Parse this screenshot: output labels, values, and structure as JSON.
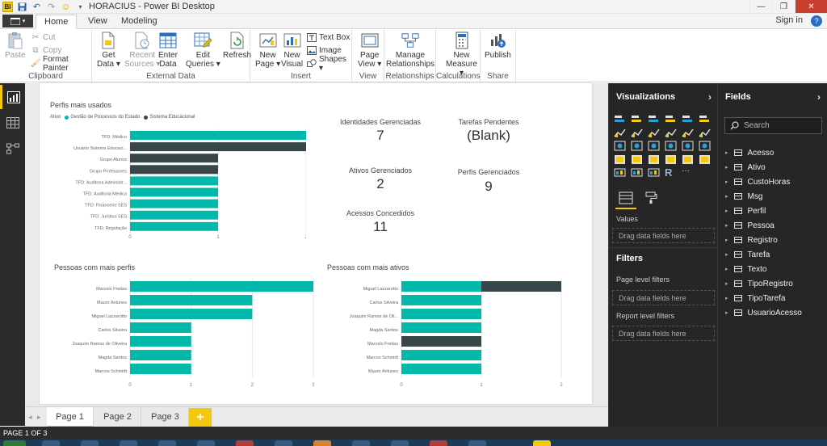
{
  "window": {
    "title": "HORACIUS - Power BI Desktop",
    "app_icon": "power-bi-logo",
    "logo_text": "BI"
  },
  "ribbon_tabs": [
    {
      "label": "Home",
      "active": true
    },
    {
      "label": "View",
      "active": false
    },
    {
      "label": "Modeling",
      "active": false
    }
  ],
  "signin_label": "Sign in",
  "help_label": "?",
  "ribbon": {
    "clipboard": {
      "label": "Clipboard",
      "paste": "Paste",
      "cut": "Cut",
      "copy": "Copy",
      "format_painter": "Format Painter"
    },
    "external_data": {
      "label": "External Data",
      "get_data": [
        "Get",
        "Data ▾"
      ],
      "recent_sources": [
        "Recent",
        "Sources ▾"
      ],
      "enter_data": [
        "Enter",
        "Data"
      ],
      "edit_queries": [
        "Edit",
        "Queries ▾"
      ],
      "refresh": "Refresh"
    },
    "insert": {
      "label": "Insert",
      "new_page": [
        "New",
        "Page ▾"
      ],
      "new_visual": [
        "New",
        "Visual"
      ],
      "text_box": "Text Box",
      "image": "Image",
      "shapes": "Shapes ▾"
    },
    "view": {
      "label": "View",
      "page_view": [
        "Page",
        "View ▾"
      ]
    },
    "relationships": {
      "label": "Relationships",
      "manage": [
        "Manage",
        "Relationships"
      ]
    },
    "calculations": {
      "label": "Calculations",
      "new_measure": [
        "New",
        "Measure ▾"
      ]
    },
    "share": {
      "label": "Share",
      "publish": "Publish"
    }
  },
  "colors": {
    "teal": "#01b8aa",
    "dark": "#374649",
    "accent": "#f2c811"
  },
  "report": {
    "chart1": {
      "title": "Perfis mais usados",
      "legend_title": "Ativo",
      "legend": [
        "Gestão de Processos do Estado",
        "Sistema Educacional"
      ]
    },
    "chart2": {
      "title": "Pessoas com mais perfis"
    },
    "chart3": {
      "title": "Pessoas com mais ativos"
    },
    "cards": [
      {
        "label": "Identidades Gerenciadas",
        "value": "7"
      },
      {
        "label": "Tarefas Pendentes",
        "value": "(Blank)"
      },
      {
        "label": "Ativos Gerenciados",
        "value": "2"
      },
      {
        "label": "Perfis Gerenciados",
        "value": "9"
      },
      {
        "label": "Acessos Concedidos",
        "value": "11"
      }
    ]
  },
  "chart_data": [
    {
      "type": "bar",
      "orientation": "horizontal",
      "title": "Perfis mais usados",
      "categories": [
        "TFD: Médico",
        "Usuário Sistema Educaci...",
        "Grupo Alunos",
        "Grupo Professores",
        "TFD: Auditoria Administr...",
        "TFD: Auditoria Médica",
        "TFD: Financeiro SES",
        "TFD: Jurídico SES",
        "TFD: Regulação"
      ],
      "series": [
        {
          "name": "Gestão de Processos do Estado",
          "values": [
            2,
            0,
            0,
            0,
            1,
            1,
            1,
            1,
            1
          ]
        },
        {
          "name": "Sistema Educacional",
          "values": [
            0,
            2,
            1,
            1,
            0,
            0,
            0,
            0,
            0
          ]
        }
      ],
      "xticks": [
        "0",
        "1",
        "2"
      ],
      "xlim": [
        0,
        2
      ]
    },
    {
      "type": "bar",
      "orientation": "horizontal",
      "title": "Pessoas com mais perfis",
      "categories": [
        "Marcelo Freitas",
        "Mauro Antunes",
        "Miguel Lazzarotto",
        "Carlos Silveira",
        "Joaquim Ramos de Oliveira",
        "Magda Santos",
        "Marcos Schmidt"
      ],
      "series": [
        {
          "values": [
            3,
            2,
            2,
            1,
            1,
            1,
            1
          ]
        }
      ],
      "xticks": [
        "0",
        "1",
        "2",
        "3"
      ],
      "xlim": [
        0,
        3
      ]
    },
    {
      "type": "bar",
      "orientation": "horizontal",
      "title": "Pessoas com mais ativos",
      "categories": [
        "Miguel Lazzarotto",
        "Carlos Silveira",
        "Joaquim Ramos de Oli...",
        "Magda Santos",
        "Marcelo Freitas",
        "Marcos Schmidt",
        "Mauro Antunes"
      ],
      "series": [
        {
          "name": "Gestão de Processos do Estado",
          "values": [
            1,
            1,
            1,
            1,
            0,
            1,
            1
          ]
        },
        {
          "name": "Sistema Educacional",
          "values": [
            1,
            0,
            0,
            0,
            1,
            0,
            0
          ]
        }
      ],
      "xticks": [
        "0",
        "1",
        "2"
      ],
      "xlim": [
        0,
        2
      ]
    }
  ],
  "pages": [
    {
      "label": "Page 1",
      "active": true
    },
    {
      "label": "Page 2",
      "active": false
    },
    {
      "label": "Page 3",
      "active": false
    }
  ],
  "add_page_label": "+",
  "visualizations": {
    "title": "Visualizations",
    "more_label": "···",
    "r_label": "R",
    "values_label": "Values",
    "drag_label": "Drag data fields here"
  },
  "filters": {
    "title": "Filters",
    "page_level": "Page level filters",
    "page_drag": "Drag data fields here",
    "report_level": "Report level filters",
    "report_drag": "Drag data fields here"
  },
  "fields": {
    "title": "Fields",
    "search_placeholder": "Search",
    "tables": [
      "Acesso",
      "Ativo",
      "CustoHoras",
      "Msg",
      "Perfil",
      "Pessoa",
      "Registro",
      "Tarefa",
      "Texto",
      "TipoRegistro",
      "TipoTarefa",
      "UsuarioAcesso"
    ]
  },
  "status": {
    "page_indicator": "PAGE 1 OF 3"
  }
}
